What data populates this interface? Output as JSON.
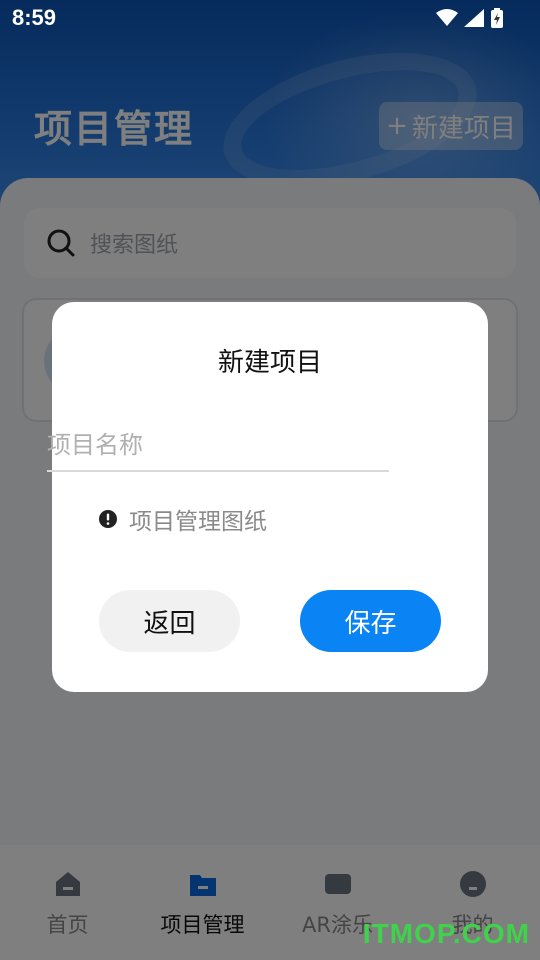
{
  "status": {
    "time": "8:59"
  },
  "header": {
    "title": "项目管理",
    "new_button_label": "新建项目",
    "new_button_plus": "+"
  },
  "search": {
    "placeholder": "搜索图纸"
  },
  "dialog": {
    "title": "新建项目",
    "name_placeholder": "项目名称",
    "hint": "项目管理图纸",
    "back_label": "返回",
    "save_label": "保存",
    "save_color": "#0a84f5"
  },
  "nav": {
    "items": [
      {
        "label": "首页",
        "icon": "home-icon"
      },
      {
        "label": "项目管理",
        "icon": "folder-icon"
      },
      {
        "label": "AR涂乐",
        "icon": "ar-icon"
      },
      {
        "label": "我的",
        "icon": "profile-icon"
      }
    ],
    "active_index": 1
  },
  "watermark": "ITMOP.COM"
}
